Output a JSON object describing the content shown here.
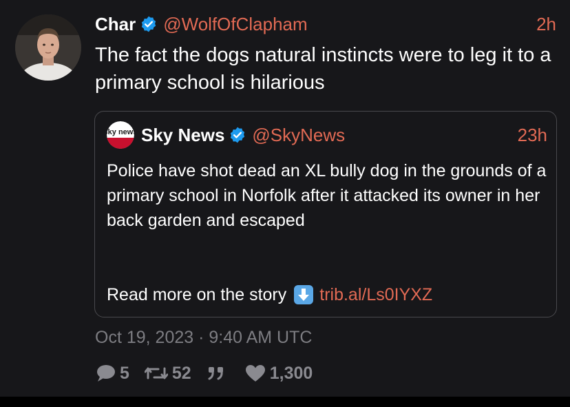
{
  "tweet": {
    "author_name": "Char",
    "author_handle": "@WolfOfClapham",
    "time_ago": "2h",
    "text": "The fact the dogs natural instincts were to leg it to a primary school is hilarious",
    "timestamp": "Oct 19, 2023 · 9:40 AM UTC"
  },
  "quote": {
    "author_name": "Sky News",
    "author_handle": "@SkyNews",
    "time_ago": "23h",
    "logo_text": "sky news",
    "text": "Police have shot dead an XL bully dog in the grounds of a primary school in Norfolk after it attacked its owner in her back garden and escaped",
    "read_more": "Read more on the story",
    "link": "trib.al/Ls0IYXZ"
  },
  "stats": {
    "replies": "5",
    "retweets": "52",
    "quotes": "",
    "likes": "1,300"
  },
  "icons": {
    "verified": "verified-badge-icon",
    "reply": "comment-icon",
    "retweet": "retweet-icon",
    "quote": "quote-icon",
    "like": "heart-icon",
    "down": "down-arrow-icon"
  },
  "colors": {
    "background": "#17171a",
    "accent_link": "#e26a54",
    "verified": "#1d9bf0",
    "muted": "#7d7d82"
  }
}
